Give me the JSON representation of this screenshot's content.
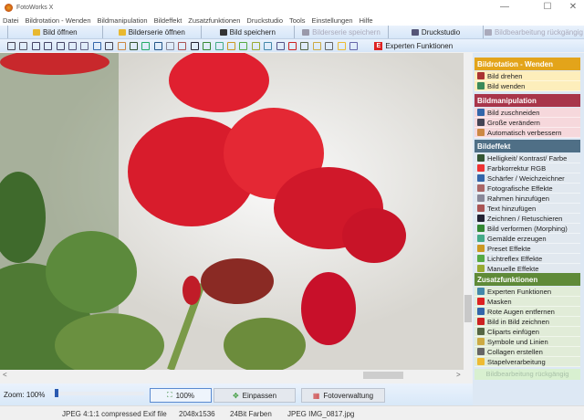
{
  "window": {
    "title": "FotoWorks X",
    "minimize": "—",
    "maximize": "☐",
    "close": "✕"
  },
  "menu": [
    "Datei",
    "Bildrotation - Wenden",
    "Bildmanipulation",
    "Bildeffekt",
    "Zusatzfunktionen",
    "Druckstudio",
    "Tools",
    "Einstellungen",
    "Hilfe"
  ],
  "toolbar": [
    {
      "label": "Bild öffnen",
      "icon": "folder-icon",
      "enabled": true
    },
    {
      "label": "Bilderserie öffnen",
      "icon": "folder-icon",
      "enabled": true
    },
    {
      "label": "Bild speichern",
      "icon": "save-icon",
      "enabled": true
    },
    {
      "label": "Bilderserie speichern",
      "icon": "save-series-icon",
      "enabled": false
    },
    {
      "label": "Druckstudio",
      "icon": "printer-icon",
      "enabled": true
    },
    {
      "label": "Bildbearbeitung rückgängig",
      "icon": "undo-icon",
      "enabled": false
    }
  ],
  "tool_icons": [
    "rotate-left-icon",
    "rotate-right-icon",
    "rotate-ccw-icon",
    "rotate-cw-icon",
    "flip-horizontal-icon",
    "flip-vertical-icon",
    "mirror-icon",
    "crop-icon",
    "resize-icon",
    "auto-enhance-icon",
    "brightness-icon",
    "color-correction-icon",
    "sharpen-icon",
    "photo-effects-icon",
    "frame-icon",
    "text-icon",
    "draw-icon",
    "morph-icon",
    "painting-icon",
    "preset-effects-icon",
    "light-reflex-icon",
    "manual-effects-icon",
    "mask-icon",
    "red-eye-icon",
    "picture-in-picture-icon",
    "cliparts-icon",
    "symbols-icon",
    "collage-icon",
    "batch-icon"
  ],
  "expert_button": "Experten Funktionen",
  "panel": {
    "sections": [
      {
        "title": "Bildrotation - Wenden",
        "color": "#e3a41a",
        "bg": "#fdeebb",
        "items": [
          "Bild drehen",
          "Bild wenden"
        ]
      },
      {
        "title": "Bildmanipulation",
        "color": "#a8354a",
        "bg": "#f6d8dc",
        "items": [
          "Bild zuschneiden",
          "Große verändern",
          "Automatisch verbessern"
        ]
      },
      {
        "title": "Bildeffekt",
        "color": "#4f6f86",
        "bg": "#e1e8ef",
        "items": [
          "Helligkeit/ Kontrast/ Farbe",
          "Farbkorrektur RGB",
          "Schärfer / Weichzeichner",
          "Fotografische Effekte",
          "Rahmen hinzufügen",
          "Text hinzufügen",
          "Zeichnen / Retuschieren",
          "Bild verformen (Morphing)",
          "Gemälde erzeugen",
          "Preset Effekte",
          "Lichtreflex Effekte",
          "Manuelle Effekte"
        ]
      },
      {
        "title": "Zusatzfunktionen",
        "color": "#5f8a38",
        "bg": "#e1ecd8",
        "items": [
          "Experten Funktionen",
          "Masken",
          "Rote Augen entfernen",
          "Bild in Bild zeichnen",
          "Cliparts einfügen",
          "Symbole und Linien",
          "Collagen erstellen",
          "Stapelverarbeitung"
        ]
      }
    ],
    "undo": "Bildbearbeitung rückgängig"
  },
  "zoom": {
    "label": "Zoom: 100%",
    "value_percent": 100,
    "btn_100": "100%",
    "btn_fit": "Einpassen",
    "btn_manager": "Fotoverwaltung"
  },
  "scroll": {
    "left": "<",
    "right": ">"
  },
  "status": {
    "format": "JPEG 4:1:1 compressed Exif file",
    "size": "2048x1536",
    "colors": "24Bit Farben",
    "file": "JPEG IMG_0817.jpg"
  }
}
